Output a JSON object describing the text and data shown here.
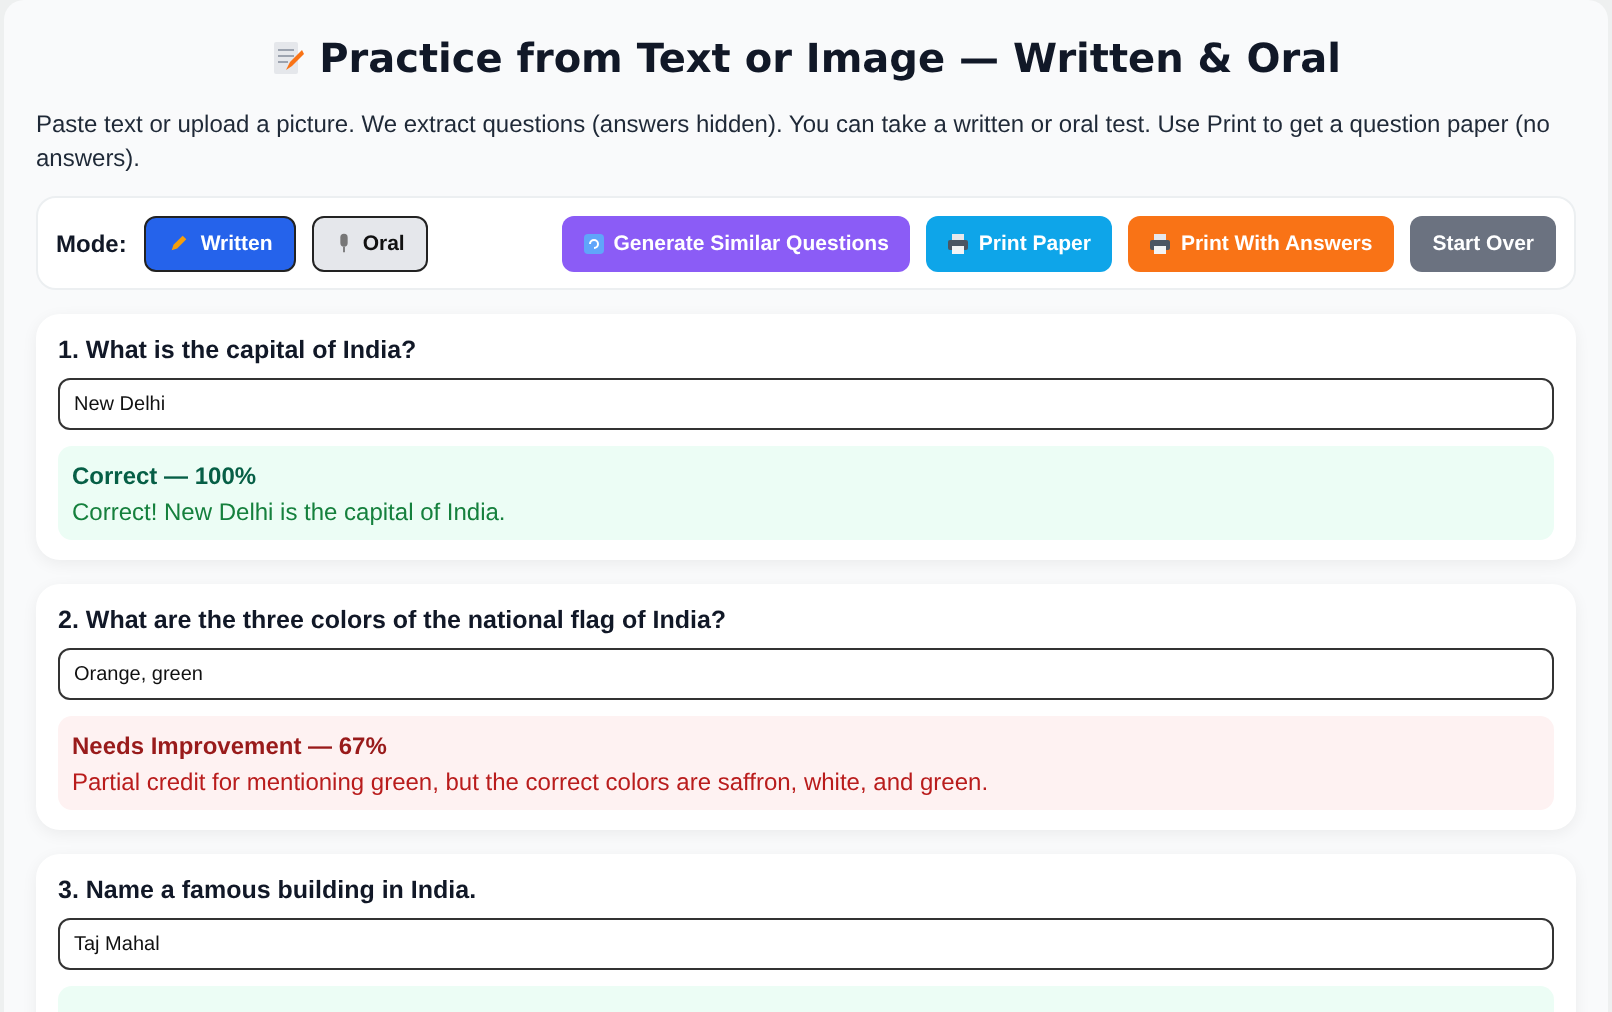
{
  "title": "Practice from Text or Image — Written & Oral",
  "description": "Paste text or upload a picture. We extract questions (answers hidden). You can take a written or oral test. Use Print to get a question paper (no answers).",
  "toolbar": {
    "mode_label": "Mode:",
    "modes": [
      {
        "label": "Written",
        "kind": "written",
        "selected": true
      },
      {
        "label": "Oral",
        "kind": "oral",
        "selected": false
      }
    ],
    "actions": [
      {
        "label": "Generate Similar Questions",
        "kind": "generate"
      },
      {
        "label": "Print Paper",
        "kind": "print"
      },
      {
        "label": "Print With Answers",
        "kind": "print-answers"
      },
      {
        "label": "Start Over",
        "kind": "reset"
      }
    ]
  },
  "questions": [
    {
      "question": "1. What is the capital of India?",
      "answer": "New Delhi",
      "result": {
        "kind": "correct",
        "heading": "Correct — 100%",
        "feedback": "Correct! New Delhi is the capital of India."
      }
    },
    {
      "question": "2. What are the three colors of the national flag of India?",
      "answer": "Orange, green",
      "result": {
        "kind": "needs-improvement",
        "heading": "Needs Improvement — 67%",
        "feedback": "Partial credit for mentioning green, but the correct colors are saffron, white, and green."
      }
    },
    {
      "question": "3. Name a famous building in India.",
      "answer": "Taj Mahal",
      "result": {
        "kind": "correct"
      }
    }
  ]
}
